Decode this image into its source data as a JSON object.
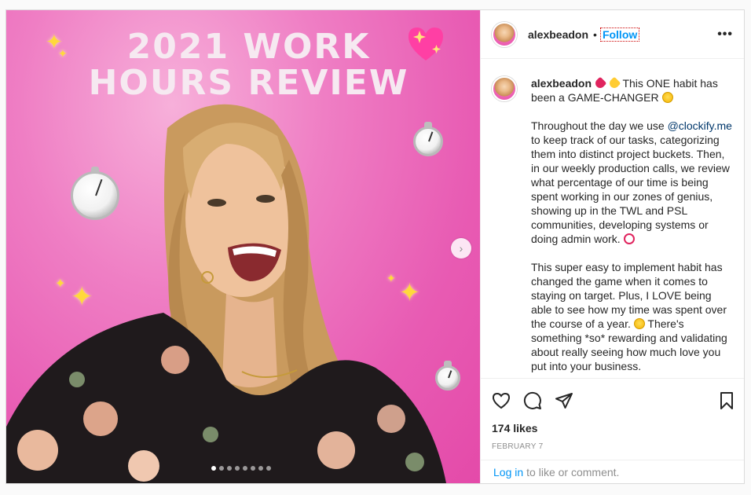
{
  "post": {
    "image": {
      "title_line1": "2021 WORK",
      "title_line2": "HOURS REVIEW",
      "carousel_count": 8,
      "carousel_active": 0
    },
    "header": {
      "username": "alexbeadon",
      "separator": "•",
      "follow_label": "Follow",
      "more_label": "•••"
    },
    "caption": {
      "username": "alexbeadon",
      "line1_text": " This ONE habit has been a GAME-CHANGER ",
      "p2_before": "Throughout the day we use ",
      "p2_mention": "@clockify.me",
      "p2_after": " to keep track of our tasks, categorizing them into distinct project buckets. Then, in our weekly production calls, we review what percentage of our time is being spent working in our zones of genius, showing up in the TWL and PSL communities, developing systems or doing admin work. ",
      "p3_before": "This super easy to implement habit has changed the game when it comes to staying on target. Plus, I LOVE being able to see how my time was spent over the course of a year. ",
      "p3_after": " There's something *so* rewarding and validating about really seeing how much love you put into your business."
    },
    "likes": "174 likes",
    "date": "FEBRUARY 7",
    "login": {
      "link": "Log in",
      "rest": "to like or comment."
    }
  }
}
